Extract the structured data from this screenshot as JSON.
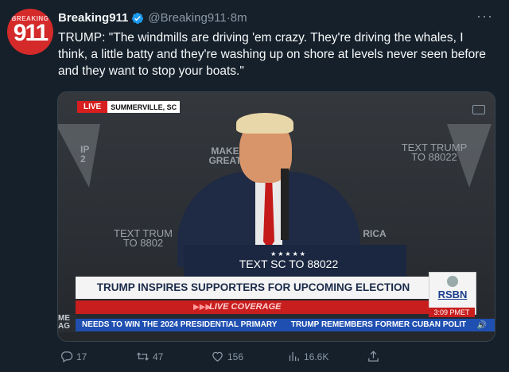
{
  "tweet": {
    "avatar": {
      "top_text": "BREAKING",
      "main_text": "911"
    },
    "display_name": "Breaking911",
    "handle": "@Breaking911",
    "separator": "·",
    "time": "8m",
    "more": "···",
    "text": "TRUMP: \"The windmills are driving 'em crazy. They're driving the whales, I think, a little batty and they're washing up on shore at levels never seen before and they want to stop your boats.\""
  },
  "media": {
    "live_label": "LIVE",
    "location": "SUMMERVILLE, SC",
    "signs": {
      "s1": "IP\n2",
      "s2": "MAKE\nGREAT",
      "s3": "TEXT TRUMP\nTO 88022",
      "s4": "TEXT TRUM\nTO 8802",
      "s5": "RICA"
    },
    "podium_stars": "★★★★★",
    "podium_text": "TEXT SC TO 88022",
    "headline": "TRUMP INSPIRES SUPPORTERS FOR UPCOMING ELECTION",
    "subheadline": "LIVE COVERAGE",
    "network": "RSBN",
    "broadcast_time": "3:09 PMET",
    "ticker_1": "NEEDS TO WIN THE 2024 PRESIDENTIAL PRIMARY",
    "ticker_2": "TRUMP REMEMBERS FORMER CUBAN POLIT",
    "left_stub": "ME\nAG"
  },
  "actions": {
    "replies": "17",
    "retweets": "47",
    "likes": "156",
    "views": "16.6K"
  },
  "colors": {
    "background": "#15202b",
    "accent_verified": "#1d9bf0",
    "muted_text": "#8b98a5",
    "live_red": "#d81e1e",
    "ticker_blue": "#1f4fb0"
  }
}
